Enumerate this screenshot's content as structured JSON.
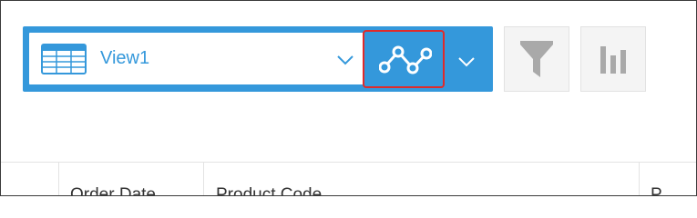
{
  "view": {
    "name": "View1",
    "icon": "table-icon",
    "chevron_icon": "chevron-down-icon"
  },
  "toolbar": {
    "graph_button_icon": "line-graph-icon",
    "graph_menu_icon": "chevron-down-icon",
    "filter_button_icon": "funnel-icon",
    "chart_button_icon": "bar-chart-icon"
  },
  "table": {
    "columns": [
      "Order Date",
      "Product Code",
      "P"
    ]
  },
  "colors": {
    "accent": "#3498db",
    "highlight": "#e02a2a",
    "tool_bg": "#f4f4f4",
    "tool_icon": "#a9a9a9"
  }
}
